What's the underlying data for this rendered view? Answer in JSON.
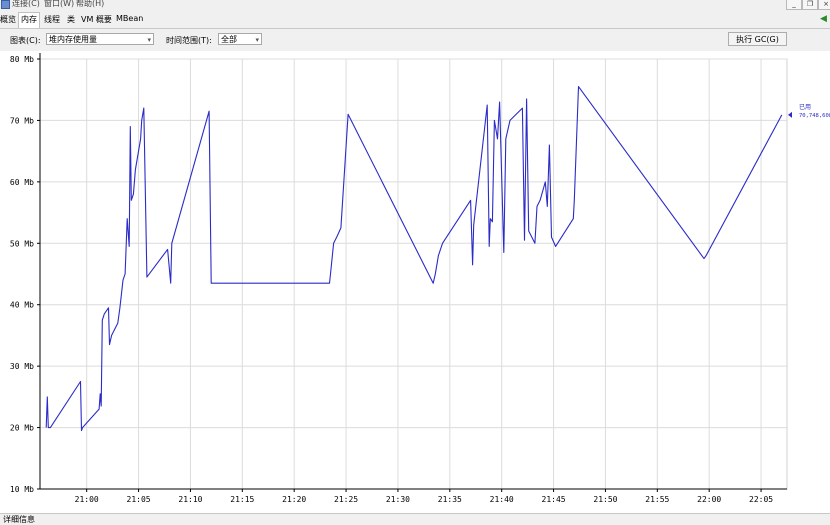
{
  "menubar": {
    "items": [
      "连接(C)",
      "窗口(W)",
      "帮助(H)"
    ],
    "window_buttons": [
      "_",
      "❐",
      "×"
    ]
  },
  "tabs": [
    "概览",
    "内存",
    "线程",
    "类",
    "VM 概要",
    "MBean"
  ],
  "active_tab": "内存",
  "toolbar": {
    "chart_label": "图表(C):",
    "chart_value": "堆内存使用量",
    "range_label": "时间范围(T):",
    "range_value": "全部",
    "gc_button": "执行 GC(G)"
  },
  "chart_data": {
    "type": "line",
    "ylim": [
      10,
      80
    ],
    "ytick_labels": [
      "80 Mb",
      "70 Mb",
      "60 Mb",
      "50 Mb",
      "40 Mb",
      "30 Mb",
      "20 Mb",
      "10 Mb"
    ],
    "xtick_labels": [
      "21:00",
      "21:05",
      "21:10",
      "21:15",
      "21:20",
      "21:25",
      "21:30",
      "21:35",
      "21:40",
      "21:45",
      "21:50",
      "21:55",
      "22:00",
      "22:05"
    ],
    "xlim_minutes_since_2055": [
      0.5,
      72.5
    ],
    "grid": true,
    "legend": {
      "label": "已用",
      "value": "70,748,608"
    },
    "series": [
      {
        "name": "已用",
        "color": "#2b2bc8",
        "x": [
          1.1,
          1.2,
          1.3,
          1.5,
          4.4,
          4.5,
          4.6,
          6.2,
          6.3,
          6.4,
          6.5,
          6.7,
          7.1,
          7.2,
          7.4,
          8.0,
          8.2,
          8.5,
          8.7,
          8.9,
          9.1,
          9.2,
          9.3,
          9.5,
          9.6,
          9.7,
          10.2,
          10.3,
          10.5,
          10.8,
          12.8,
          13.1,
          13.2,
          16.8,
          17.0,
          28.4,
          28.5,
          28.8,
          29.1,
          29.5,
          30.2,
          38.4,
          38.6,
          38.9,
          39.3,
          42.0,
          42.2,
          42.3,
          43.6,
          43.8,
          43.9,
          44.1,
          44.3,
          44.6,
          44.8,
          45.2,
          45.4,
          45.8,
          47.0,
          47.2,
          47.4,
          47.6,
          48.2,
          48.4,
          48.7,
          49.2,
          49.4,
          49.6,
          49.8,
          50.2,
          51.9,
          52.0,
          52.4,
          64.5,
          64.7,
          72.0
        ],
        "y": [
          20,
          25,
          20,
          20,
          27.5,
          19.5,
          20,
          23,
          25.5,
          23.5,
          37.5,
          38.5,
          39.5,
          33.5,
          35,
          37,
          39.5,
          44,
          45,
          54,
          49.5,
          69,
          57,
          58,
          60,
          62,
          67,
          70,
          72,
          44.5,
          49,
          43.5,
          50,
          71.5,
          43.5,
          43.5,
          45,
          50,
          51,
          52.5,
          71,
          43.5,
          45,
          48,
          50,
          57,
          46.5,
          53,
          72.5,
          49.5,
          54,
          53.5,
          70,
          67,
          73,
          48.5,
          67,
          70,
          72,
          50.5,
          73.5,
          52,
          50,
          56,
          57,
          60,
          56,
          66,
          51,
          49.5,
          54,
          57,
          75.5,
          47.5,
          48,
          70.9
        ]
      }
    ]
  },
  "status": {
    "details": "详细信息"
  }
}
